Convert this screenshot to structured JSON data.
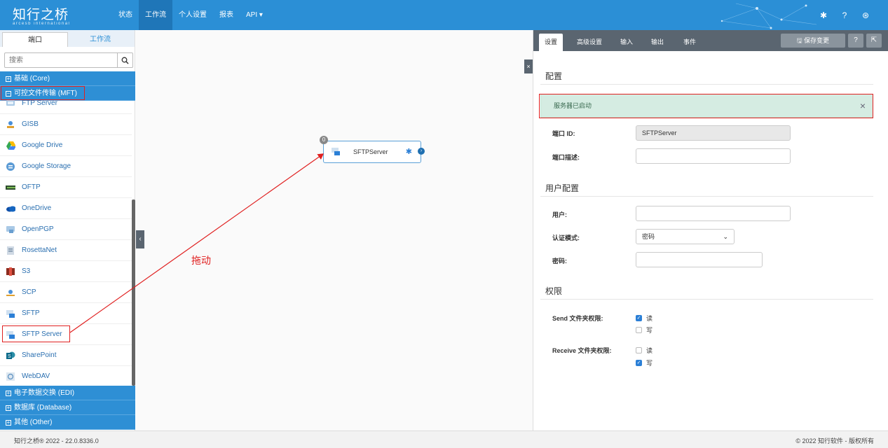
{
  "app": {
    "logo_text": "知行之桥",
    "logo_sub": "arcesb international"
  },
  "nav": {
    "items": [
      "状态",
      "工作流",
      "个人设置",
      "报表",
      "API ▾"
    ],
    "active": "工作流"
  },
  "left": {
    "tabs": [
      "端口",
      "工作流"
    ],
    "search_placeholder": "搜索",
    "categories_top": [
      "基础 (Core)",
      "可控文件传输 (MFT)"
    ],
    "items": [
      "FTP Server",
      "GISB",
      "Google Drive",
      "Google Storage",
      "OFTP",
      "OneDrive",
      "OpenPGP",
      "RosettaNet",
      "S3",
      "SCP",
      "SFTP",
      "SFTP Server",
      "SharePoint",
      "WebDAV"
    ],
    "categories_bottom": [
      "电子数据交换 (EDI)",
      "数据库 (Database)",
      "其他 (Other)"
    ]
  },
  "canvas": {
    "node_label": "SFTPServer",
    "node_badge": "0",
    "annotation": "拖动"
  },
  "right": {
    "tabs": [
      "设置",
      "高级设置",
      "输入",
      "输出",
      "事件"
    ],
    "save_label": "保存变更",
    "section_config": "配置",
    "alert_text": "服务器已启动",
    "port_id_label": "端口 ID:",
    "port_id_value": "SFTPServer",
    "port_desc_label": "端口描述:",
    "port_desc_value": "",
    "section_user": "用户配置",
    "user_label": "用户:",
    "user_value": "",
    "auth_label": "认证模式:",
    "auth_value": "密码",
    "password_label": "密码:",
    "password_value": "",
    "section_perm": "权限",
    "send_label": "Send 文件夹权限:",
    "receive_label": "Receive 文件夹权限:",
    "read_label": "读",
    "write_label": "写",
    "send_read": true,
    "send_write": false,
    "recv_read": false,
    "recv_write": true
  },
  "footer": {
    "left": "知行之桥® 2022 - 22.0.8336.0",
    "right": "© 2022 知行软件 - 版权所有"
  },
  "colors": {
    "brand": "#2b8fd6",
    "category": "#2e8fd5",
    "panel_header": "#5a6570",
    "annotation": "#e02020"
  }
}
